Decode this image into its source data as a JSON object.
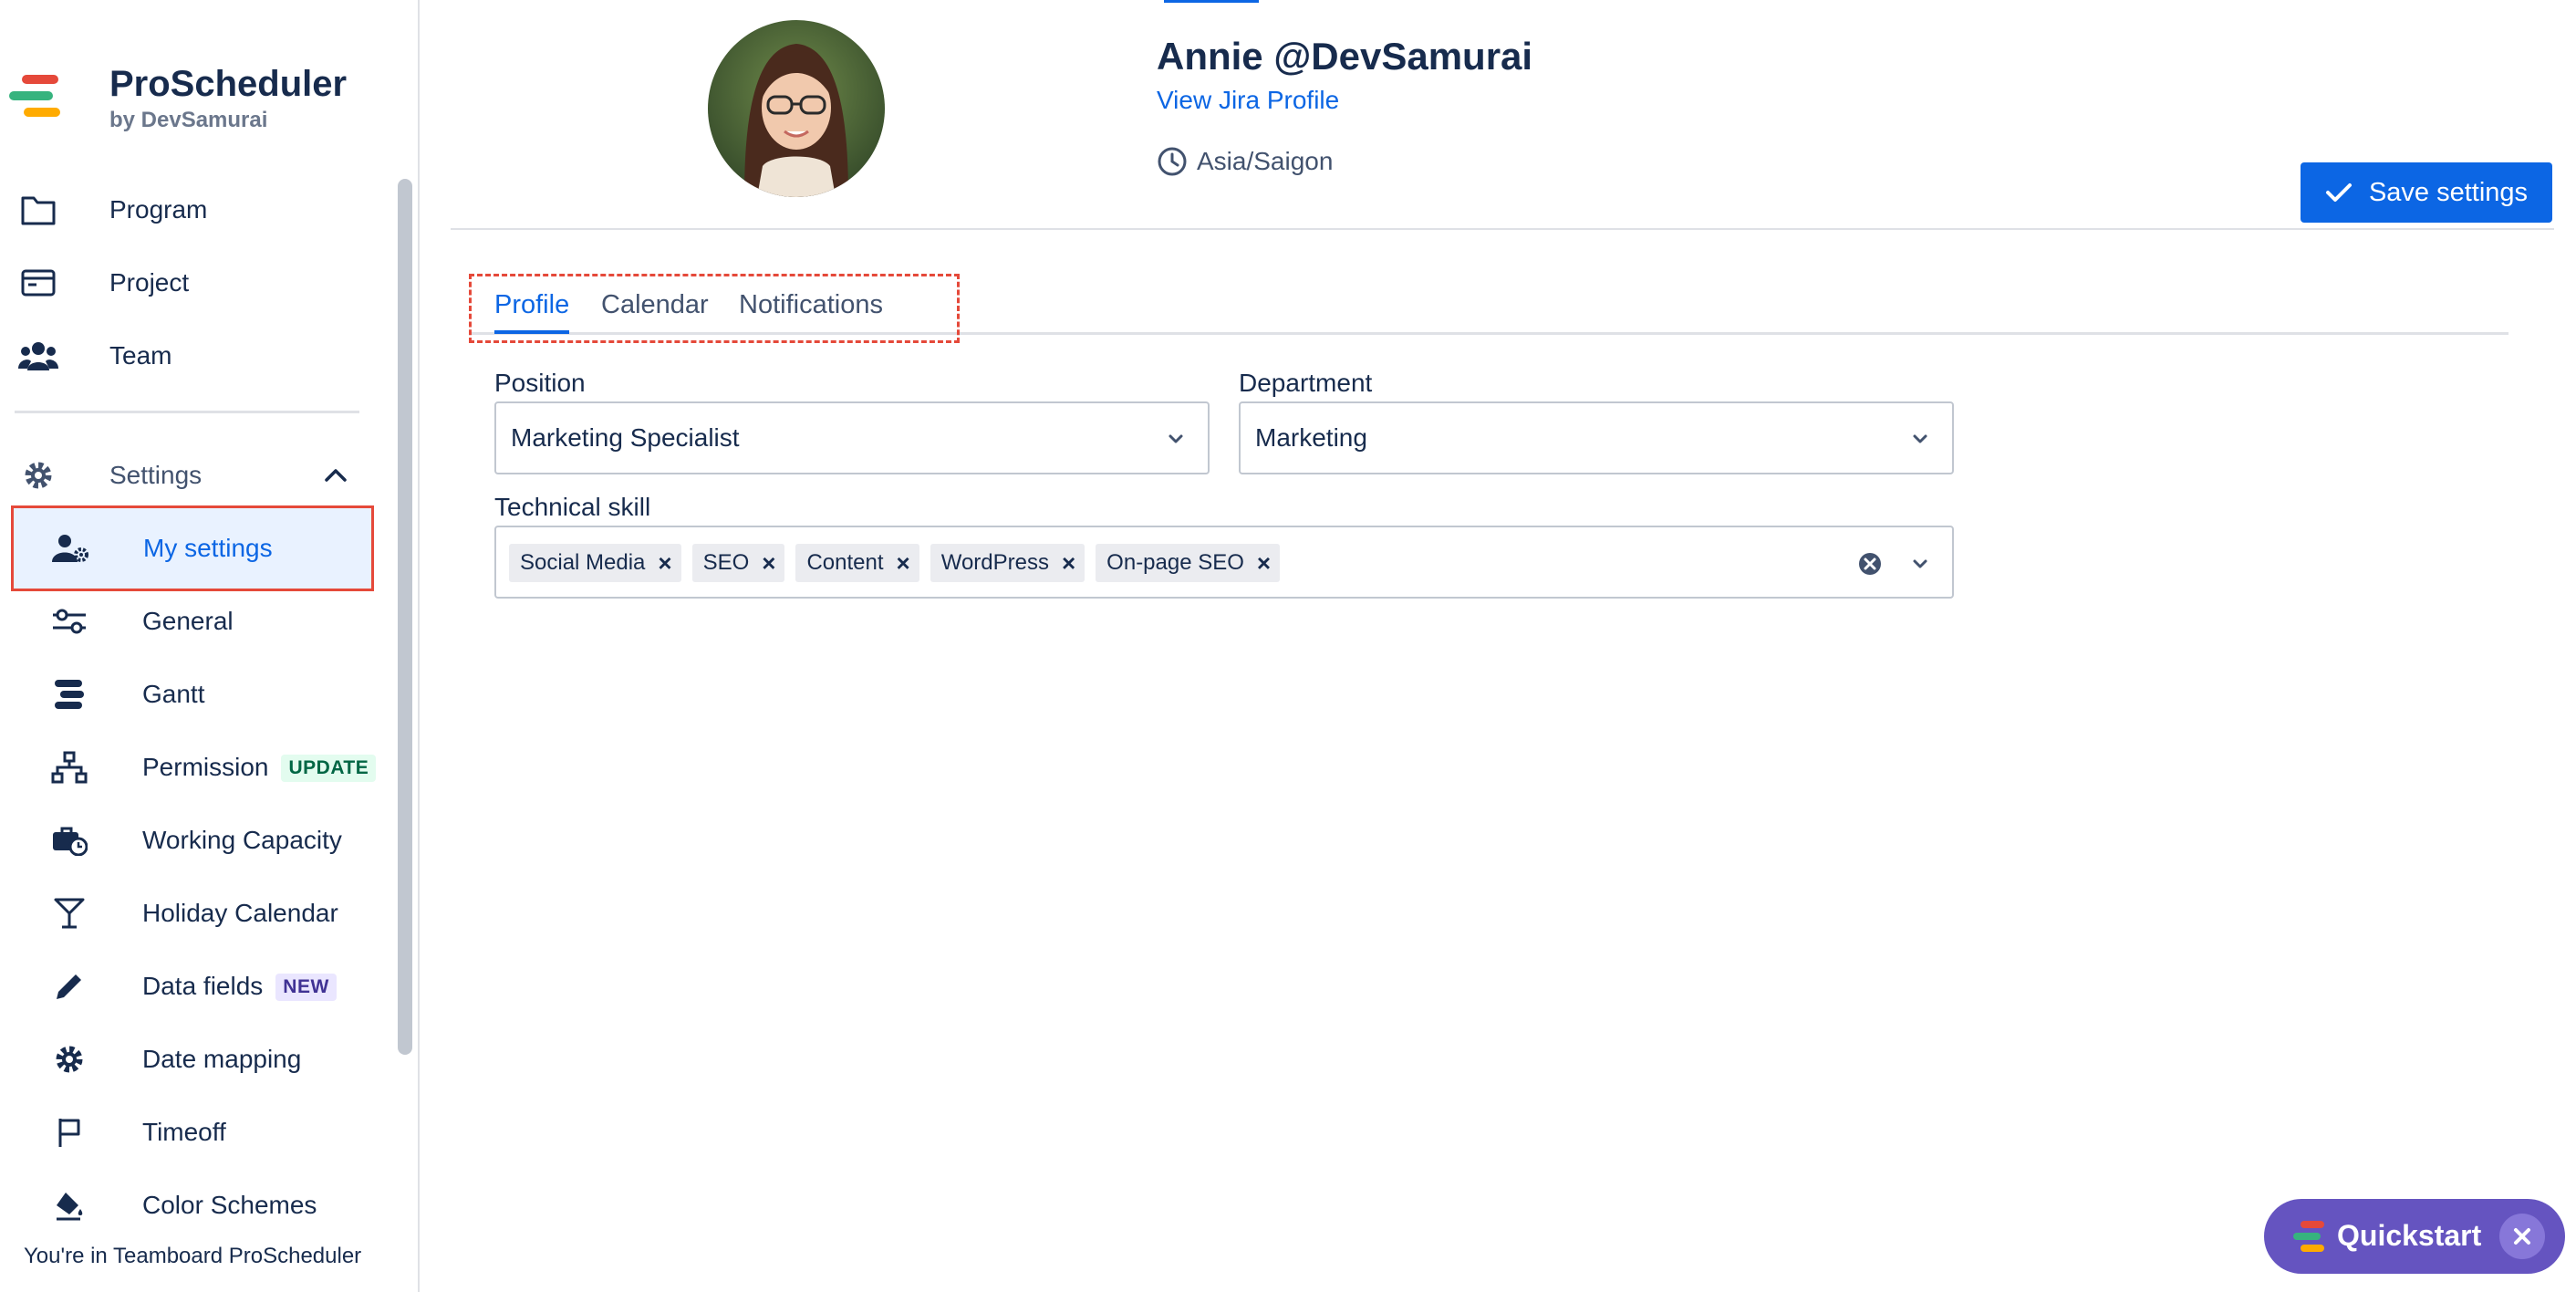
{
  "brand": {
    "title": "ProScheduler",
    "subtitle": "by DevSamurai"
  },
  "nav": {
    "main": [
      {
        "label": "Program",
        "icon": "folder-icon"
      },
      {
        "label": "Project",
        "icon": "project-icon"
      },
      {
        "label": "Team",
        "icon": "team-icon"
      }
    ],
    "settings_label": "Settings",
    "settings_items": [
      {
        "label": "My settings",
        "icon": "user-gear-icon",
        "active": true
      },
      {
        "label": "General",
        "icon": "sliders-icon"
      },
      {
        "label": "Gantt",
        "icon": "gantt-icon"
      },
      {
        "label": "Permission",
        "icon": "hierarchy-icon",
        "badge": "UPDATE"
      },
      {
        "label": "Working Capacity",
        "icon": "briefcase-clock-icon"
      },
      {
        "label": "Holiday Calendar",
        "icon": "cocktail-icon"
      },
      {
        "label": "Data fields",
        "icon": "pencil-icon",
        "badge": "NEW"
      },
      {
        "label": "Date mapping",
        "icon": "gear-icon"
      },
      {
        "label": "Timeoff",
        "icon": "flag-icon"
      },
      {
        "label": "Color Schemes",
        "icon": "paint-bucket-icon"
      }
    ]
  },
  "footer": {
    "text": "You're in Teamboard ProScheduler"
  },
  "profile": {
    "name": "Annie @DevSamurai",
    "jira_link": "View Jira Profile",
    "timezone": "Asia/Saigon"
  },
  "actions": {
    "save_label": "Save settings"
  },
  "tabs": [
    {
      "label": "Profile",
      "active": true
    },
    {
      "label": "Calendar",
      "active": false
    },
    {
      "label": "Notifications",
      "active": false
    }
  ],
  "form": {
    "position_label": "Position",
    "position_value": "Marketing Specialist",
    "department_label": "Department",
    "department_value": "Marketing",
    "skill_label": "Technical skill",
    "skills": [
      "Social Media",
      "SEO",
      "Content",
      "WordPress",
      "On-page SEO"
    ]
  },
  "quickstart": {
    "label": "Quickstart"
  },
  "colors": {
    "accent": "#0c66e4",
    "highlight": "#e5493a",
    "quickstart": "#6554c0"
  }
}
